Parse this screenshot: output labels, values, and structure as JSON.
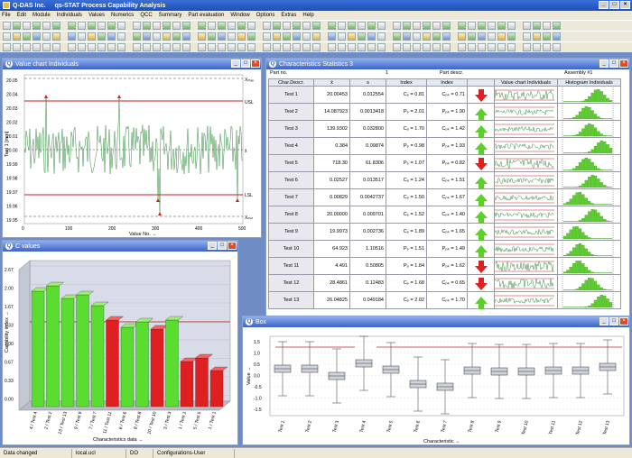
{
  "app": {
    "company": "Q-DAS Inc.",
    "title": "qs-STAT Process Capability Analysis"
  },
  "menu": [
    "File",
    "Edit",
    "Module",
    "Individuals",
    "Values",
    "Numerics",
    "QCC",
    "Summary",
    "Part evaluation",
    "Window",
    "Options",
    "Extras",
    "Help"
  ],
  "windows": {
    "value_chart": {
      "title": "Value chart Individuals"
    },
    "c_values": {
      "title": "C values"
    },
    "stats": {
      "title": "Characteristics Statistics 3"
    },
    "box": {
      "title": "Box"
    }
  },
  "stats": {
    "part_no": "Part no.",
    "part_no_val": "1",
    "part_descr": "Part descr.",
    "assembly": "Assembly #1",
    "headers": [
      "Char.Descr.",
      "x̄",
      "s",
      "Index",
      "Index",
      "",
      "Value chart Individuals",
      "Histogram Individuals"
    ],
    "rows": [
      {
        "name": "Test 1",
        "mean": "20.00453",
        "s": "0.012554",
        "i1": "Cₚ = 0.81",
        "i2": "Cₚₖ = 0.71",
        "ok": false
      },
      {
        "name": "Test 2",
        "mean": "14.087923",
        "s": "0.0013418",
        "i1": "Pₚ = 2.01",
        "i2": "Pₚₖ = 1.90",
        "ok": true
      },
      {
        "name": "Test 3",
        "mean": "139.9302",
        "s": "0.032800",
        "i1": "Cₚ = 1.70",
        "i2": "Cₚₖ = 1.42",
        "ok": true
      },
      {
        "name": "Test 4",
        "mean": "0.384",
        "s": "0.09874",
        "i1": "Pₚ = 0.98",
        "i2": "Pₚₖ = 1.93",
        "ok": true
      },
      {
        "name": "Test 5",
        "mean": "718.30",
        "s": "61.8306",
        "i1": "Pₚ = 1.07",
        "i2": "Pₚₖ = 0.82",
        "ok": false
      },
      {
        "name": "Test 6",
        "mean": "0.02527",
        "s": "0.013517",
        "i1": "Cₚ = 1.24",
        "i2": "Cₚₖ = 1.51",
        "ok": true
      },
      {
        "name": "Test 7",
        "mean": "0.00829",
        "s": "0.0042737",
        "i1": "Cₚ = 1.50",
        "i2": "Cₚₖ = 1.67",
        "ok": true
      },
      {
        "name": "Test 8",
        "mean": "20.00000",
        "s": "0.009701",
        "i1": "Cₚ = 1.52",
        "i2": "Cₚₖ = 1.40",
        "ok": true
      },
      {
        "name": "Test 9",
        "mean": "19.9973",
        "s": "0.002736",
        "i1": "Cₚ = 1.89",
        "i2": "Cₚₖ = 1.65",
        "ok": true
      },
      {
        "name": "Test 10",
        "mean": "64.923",
        "s": "1.10516",
        "i1": "Pₚ = 1.51",
        "i2": "Pₚₖ = 1.49",
        "ok": true
      },
      {
        "name": "Test 11",
        "mean": "4.491",
        "s": "0.50805",
        "i1": "Pₚ = 1.84",
        "i2": "Pₚₖ = 1.62",
        "ok": false
      },
      {
        "name": "Test 12",
        "mean": "28.4861",
        "s": "0.12483",
        "i1": "Cₚ = 1.68",
        "i2": "Cₚₖ = 0.65",
        "ok": false
      },
      {
        "name": "Test 13",
        "mean": "26.04825",
        "s": "0.049184",
        "i1": "Cₚ = 2.02",
        "i2": "Cₚₖ = 1.70",
        "ok": true
      }
    ]
  },
  "value_chart": {
    "ylabel": "Test 1 [mm]",
    "xlabel": "Value No. →",
    "yticks": [
      "20.05",
      "20.04",
      "20.03",
      "20.02",
      "20.01",
      "20.00",
      "19.99",
      "19.98",
      "19.97",
      "19.96",
      "19.95"
    ],
    "xticks": [
      "0",
      "100",
      "200",
      "300",
      "400",
      "500"
    ],
    "limit_labels": [
      "Xₘₐₓ",
      "USL",
      "x̄",
      "LSL",
      "Xₘᵢₙ"
    ]
  },
  "c_values": {
    "ylabel": "Capability index →",
    "xlabel": "Characteristics data →",
    "yticks": [
      "2.67",
      "2.00",
      "1.67",
      "1.33",
      "1.00",
      "0.67",
      "0.33",
      "0.00"
    ],
    "categories": [
      "4 / Test 4",
      "2 / Test 2",
      "13 / Test 13",
      "9 / Test 9",
      "7 / Test 7",
      "11 / Test 11",
      "6 / Test 6",
      "8 / Test 8",
      "10 / Test 10",
      "3 / Test 3",
      "1 / Test 1",
      "5 / Test 5",
      "1 / Test 1"
    ]
  },
  "box": {
    "ylabel": "Value →",
    "xlabel": "Characteristic →",
    "yticks": [
      "1.5",
      "1.0",
      "0.5",
      "0.0",
      "-0.5",
      "-1.0",
      "-1.5"
    ],
    "categories": [
      "Test 1",
      "Test 2",
      "Test 3",
      "Test 4",
      "Test 5",
      "Test 6",
      "Test 7",
      "Test 8",
      "Test 9",
      "Test 10",
      "Test 11",
      "Test 12",
      "Test 13"
    ]
  },
  "status": [
    "Data changed",
    "local.ucl",
    "DO",
    "Configurations-User"
  ]
}
